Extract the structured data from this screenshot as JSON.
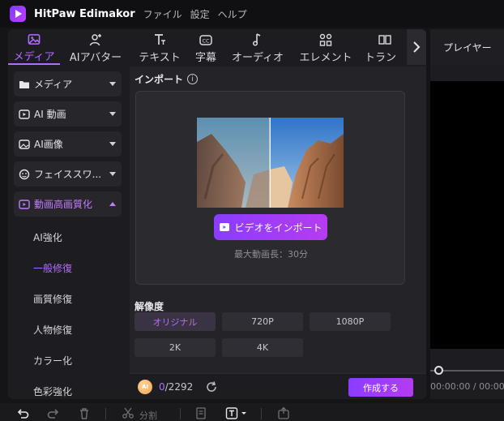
{
  "app": {
    "name": "HitPaw Edimakor"
  },
  "menu": [
    "ファイル",
    "設定",
    "ヘルプ"
  ],
  "tabs": [
    {
      "label": "メディア",
      "icon": "media-icon",
      "active": true
    },
    {
      "label": "AIアバター",
      "icon": "ai-avatar-icon"
    },
    {
      "label": "テキスト",
      "icon": "text-icon"
    },
    {
      "label": "字幕",
      "icon": "subtitle-icon"
    },
    {
      "label": "オーディオ",
      "icon": "audio-icon"
    },
    {
      "label": "エレメント",
      "icon": "element-icon"
    },
    {
      "label": "トラン",
      "icon": "transition-icon"
    }
  ],
  "sidebar": {
    "categories": [
      {
        "label": "メディア",
        "icon": "folder-icon"
      },
      {
        "label": "AI 動画",
        "icon": "ai-video-icon"
      },
      {
        "label": "AI画像",
        "icon": "ai-image-icon"
      },
      {
        "label": "フェイススワ...",
        "icon": "face-swap-icon"
      },
      {
        "label": "動画高画質化",
        "icon": "video-enhance-icon",
        "open": true
      }
    ],
    "subitems": [
      {
        "label": "AI強化"
      },
      {
        "label": "一般修復",
        "active": true
      },
      {
        "label": "画質修復"
      },
      {
        "label": "人物修復"
      },
      {
        "label": "カラー化"
      },
      {
        "label": "色彩強化"
      }
    ]
  },
  "import": {
    "title": "インポート",
    "info_glyph": "i",
    "button": "ビデオをインポート",
    "max_length": "最大動画長：30分"
  },
  "resolution": {
    "label": "解像度",
    "options": [
      {
        "label": "オリジナル",
        "selected": true
      },
      {
        "label": "720P"
      },
      {
        "label": "1080P"
      },
      {
        "label": "2K"
      },
      {
        "label": "4K"
      }
    ]
  },
  "footer": {
    "coin_label": "AI",
    "credits_used": "0",
    "credits_total": "/2292",
    "create_button": "作成する"
  },
  "player": {
    "title": "プレイヤー",
    "time_current": "00:00:00",
    "time_total": "/ 00:00"
  },
  "toolbar": {
    "split_label": "分割"
  },
  "colors": {
    "accent": "#b46cff",
    "button_gradient_start": "#8b3cff",
    "button_gradient_end": "#b43cf0"
  }
}
